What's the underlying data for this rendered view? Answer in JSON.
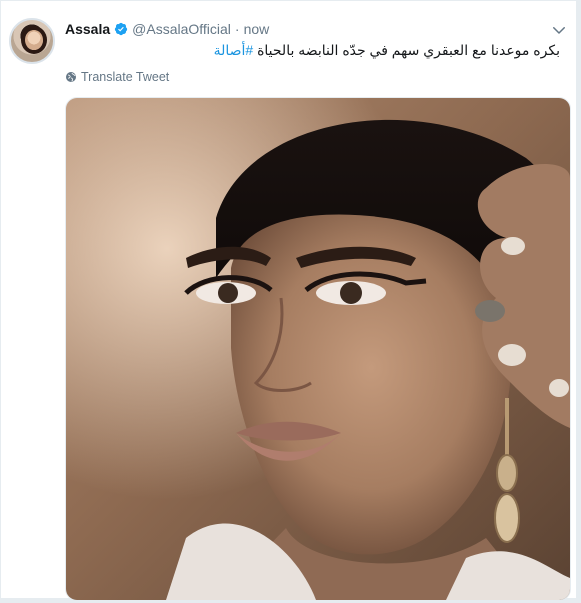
{
  "tweet": {
    "author_name": "Assala",
    "handle": "@AssalaOfficial",
    "separator": "·",
    "time": "now",
    "text": "بكره موعدنا مع العبقري سهم في جدّه النابضه بالحياة",
    "hashtag": "#أصالة",
    "translate_label": "Translate Tweet",
    "link_color": "#1b95e0",
    "verified_color": "#1da1f2"
  },
  "icons": {
    "verified": "verified-badge-icon",
    "caret": "chevron-down-icon",
    "translate": "globe-icon"
  }
}
